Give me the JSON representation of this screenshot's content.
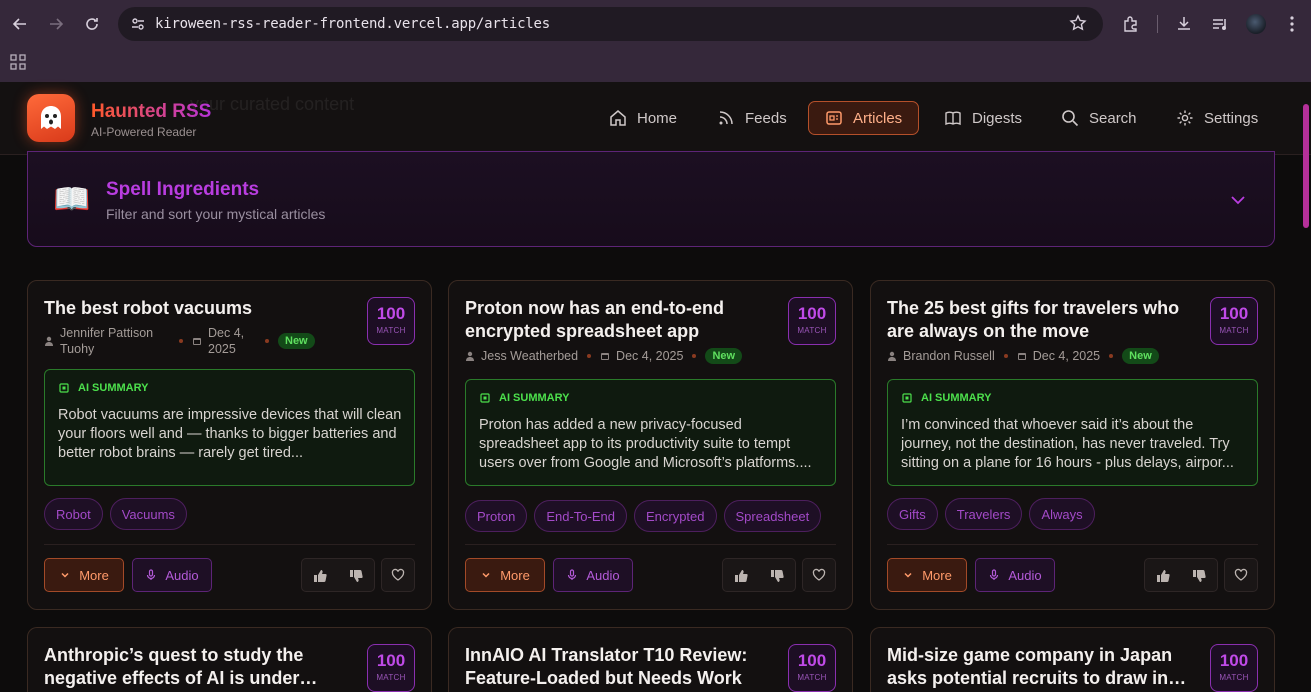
{
  "browser": {
    "url": "kiroween-rss-reader-frontend.vercel.app/articles"
  },
  "app": {
    "brand": "Haunted RSS",
    "tagline": "AI-Powered Reader",
    "ghost_text": "your curated content",
    "nav": [
      {
        "label": "Home",
        "icon": "home-icon"
      },
      {
        "label": "Feeds",
        "icon": "rss-icon"
      },
      {
        "label": "Articles",
        "icon": "newspaper-icon",
        "active": true
      },
      {
        "label": "Digests",
        "icon": "book-open-icon"
      },
      {
        "label": "Search",
        "icon": "search-icon"
      },
      {
        "label": "Settings",
        "icon": "gear-icon"
      }
    ]
  },
  "filters": {
    "title": "Spell Ingredients",
    "subtitle": "Filter and sort your mystical articles",
    "emoji": "📖"
  },
  "card_labels": {
    "match": "MATCH",
    "new": "New",
    "ai_summary": "AI SUMMARY",
    "more": "More",
    "audio": "Audio"
  },
  "articles": [
    {
      "title": "The best robot vacuums",
      "author": "Jennifer Pattison Tuohy",
      "date": "Dec 4, 2025",
      "score": "100",
      "summary": "Robot vacuums are impressive devices that will clean your floors well and — thanks to bigger batteries and better robot brains — rarely get tired...",
      "tags": [
        "Robot",
        "Vacuums"
      ]
    },
    {
      "title": "Proton now has an end-to-end encrypted spreadsheet app",
      "author": "Jess Weatherbed",
      "date": "Dec 4, 2025",
      "score": "100",
      "summary": "Proton has added a new privacy-focused spreadsheet app to its productivity suite to tempt users over from Google and Microsoft’s platforms....",
      "tags": [
        "Proton",
        "End-To-End",
        "Encrypted",
        "Spreadsheet"
      ]
    },
    {
      "title": "The 25 best gifts for travelers who are always on the move",
      "author": "Brandon Russell",
      "date": "Dec 4, 2025",
      "score": "100",
      "summary": "I’m convinced that whoever said it’s about the journey, not the destination, has never traveled. Try sitting on a plane for 16 hours - plus delays, airpor...",
      "tags": [
        "Gifts",
        "Travelers",
        "Always"
      ]
    },
    {
      "title": "Anthropic’s quest to study the negative effects of AI is under…",
      "score": "100"
    },
    {
      "title": "InnAIO AI Translator T10 Review: Feature-Loaded but Needs Work",
      "score": "100"
    },
    {
      "title": "Mid-size game company in Japan asks potential recruits to draw in…",
      "score": "100"
    }
  ]
}
